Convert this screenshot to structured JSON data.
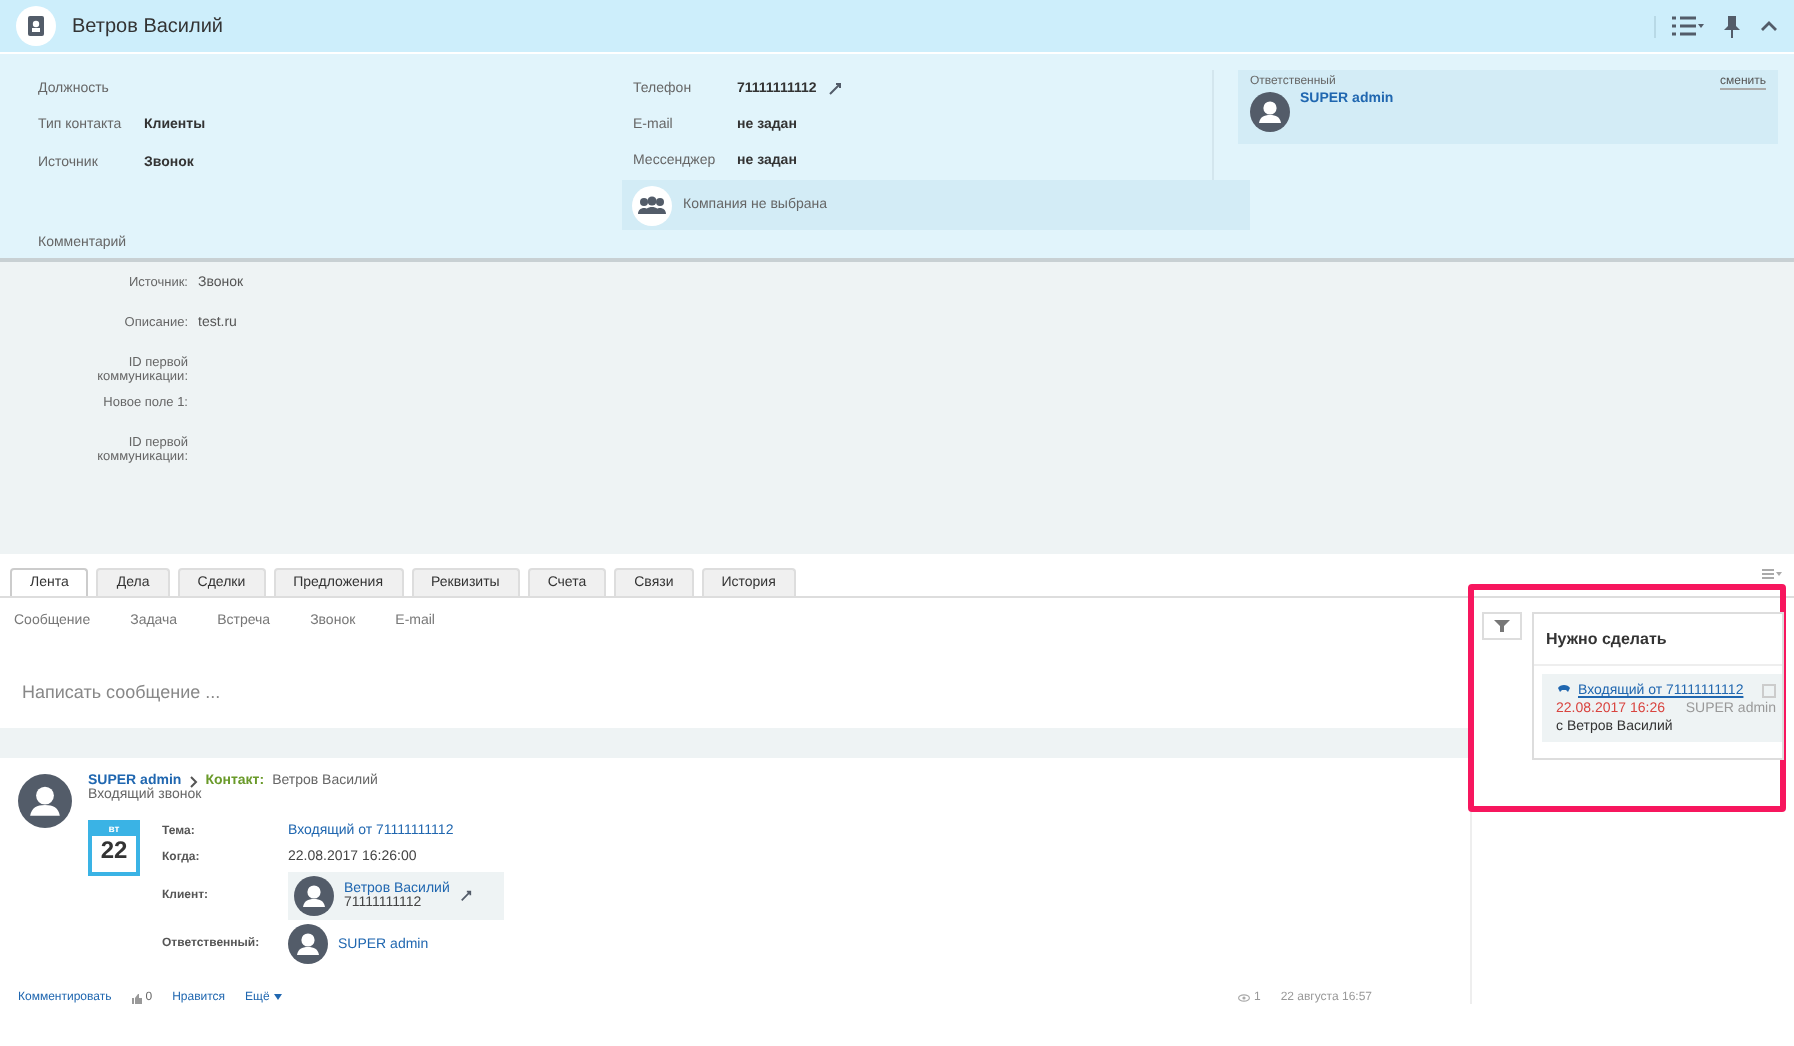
{
  "header": {
    "title": "Ветров Василий"
  },
  "info_left": [
    {
      "label": "Должность"
    },
    {
      "label": "Тип контакта",
      "value": "Клиенты"
    },
    {
      "label": "Источник",
      "value": "Звонок"
    }
  ],
  "comment_label": "Комментарий",
  "info_mid": [
    {
      "label": "Телефон",
      "value": "71111111112"
    },
    {
      "label": "E-mail",
      "value": "не задан"
    },
    {
      "label": "Мессенджер",
      "value": "не задан"
    }
  ],
  "company": "Компания не выбрана",
  "responsible": {
    "label": "Ответственный",
    "change": "сменить",
    "name": "SUPER admin"
  },
  "details": [
    {
      "label": "Источник:",
      "value": "Звонок"
    },
    {
      "label": "Описание:",
      "value": "test.ru"
    },
    {
      "label": "ID первой коммуникации:"
    },
    {
      "label": "Новое поле 1:"
    },
    {
      "label": "ID первой коммуникации:"
    }
  ],
  "tabs": [
    {
      "label": "Лента",
      "selected": true
    },
    {
      "label": "Дела",
      "selected": false
    },
    {
      "label": "Сделки",
      "selected": false
    },
    {
      "label": "Предложения",
      "selected": false
    },
    {
      "label": "Реквизиты",
      "selected": false
    },
    {
      "label": "Счета",
      "selected": false
    },
    {
      "label": "Связи",
      "selected": false
    },
    {
      "label": "История",
      "selected": false
    }
  ],
  "composer": {
    "actions": [
      "Сообщение",
      "Задача",
      "Встреча",
      "Звонок",
      "E-mail"
    ],
    "placeholder": "Написать сообщение ..."
  },
  "post": {
    "author": "SUPER admin",
    "target_label": "Контакт:",
    "target": "Ветров Василий",
    "subtitle": "Входящий звонок",
    "calendar": {
      "weekday": "вт",
      "day": "22"
    },
    "fields": [
      {
        "kind": "link",
        "label": "Тема:",
        "value": "Входящий от 71111111112"
      },
      {
        "kind": "text",
        "label": "Когда:",
        "value": "22.08.2017 16:26:00"
      },
      {
        "kind": "client",
        "label": "Клиент:",
        "name": "Ветров Василий",
        "phone": "71111111112"
      },
      {
        "kind": "person",
        "label": "Ответственный:",
        "name": "SUPER admin"
      }
    ],
    "footer": {
      "comment": "Комментировать",
      "likes": "0",
      "like": "Нравится",
      "more": "Ещё",
      "views": "1",
      "date": "22 августа 16:57"
    }
  },
  "todo": {
    "title": "Нужно сделать",
    "items": [
      {
        "title": "Входящий от 71111111112",
        "date": "22.08.2017 16:26",
        "owner": "SUPER admin",
        "with": "с Ветров Василий",
        "checked": false
      }
    ]
  }
}
